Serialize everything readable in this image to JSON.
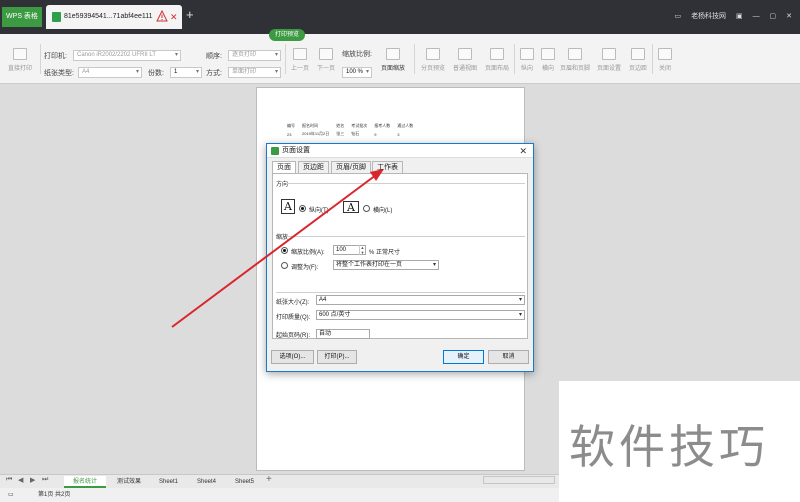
{
  "titlebar": {
    "app_tab": "WPS 表格",
    "doc_tab": "81e59394541...71abf4ee111",
    "user": "老杨科技网"
  },
  "toolbar": {
    "badge": "打印预览",
    "direct_print": "直接打印",
    "printer_label": "打印机:",
    "printer_value": "Canon iR2002/2202 UFRII LT",
    "paper_label": "纸张类型:",
    "paper_value": "A4",
    "order_label": "顺序:",
    "order_value": "逐页打印",
    "copies_label": "份数:",
    "copies_value": "1",
    "mode_label": "方式:",
    "mode_value": "单面打印",
    "prev_page": "上一页",
    "next_page": "下一页",
    "zoom_label": "缩放比例:",
    "zoom_value": "100 %",
    "page_zoom": "页面缩放",
    "tools": [
      "分页预览",
      "普通视图",
      "页面布局",
      "纵向",
      "横向",
      "页眉和页脚",
      "页面设置",
      "页边距",
      "关闭"
    ]
  },
  "page": {
    "headers": [
      "编号",
      "报名时间",
      "姓名",
      "考试批次",
      "报考人数",
      "通过人数"
    ],
    "row": [
      "23",
      "2019年11月2日",
      "张三",
      "钻石",
      "9",
      "3"
    ]
  },
  "dialog": {
    "title": "页面设置",
    "tabs": [
      "页面",
      "页边距",
      "页眉/页脚",
      "工作表"
    ],
    "orientation_group": "方向",
    "portrait": "纵向(T)",
    "landscape": "横向(L)",
    "scale_group": "缩放",
    "scale_label": "缩放比例(A):",
    "scale_value": "100",
    "scale_suffix": "% 正常尺寸",
    "fit_label": "调整为(F):",
    "fit_value": "将整个工作表打印在一页",
    "paper_size_label": "纸张大小(Z):",
    "paper_size_value": "A4",
    "quality_label": "打印质量(Q):",
    "quality_value": "600 点/英寸",
    "first_page_label": "起始页码(R):",
    "first_page_value": "自动",
    "options_btn": "选项(O)...",
    "print_btn": "打印(P)...",
    "ok_btn": "确定",
    "cancel_btn": "取消"
  },
  "sheets": {
    "tabs": [
      "报名统计",
      "测试效果",
      "Sheet1",
      "Sheet4",
      "Sheet5"
    ],
    "active": "报名统计"
  },
  "status": {
    "page_info": "第1页 共2页"
  },
  "watermark": "软件技巧",
  "colors": {
    "accent": "#3c9a43",
    "dialog_border": "#1979ca",
    "arrow": "#d9262c"
  }
}
